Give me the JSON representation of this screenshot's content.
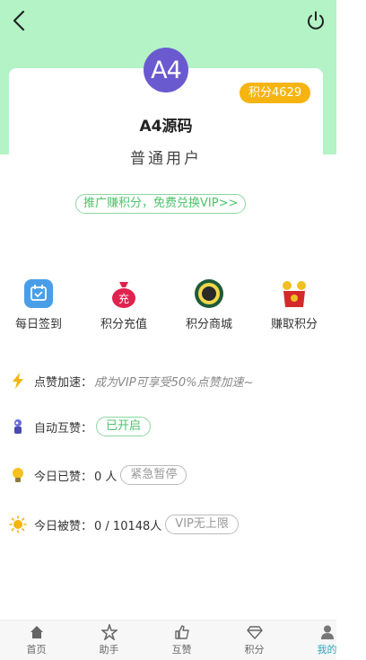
{
  "header": {
    "back_icon": "back-arrow-icon",
    "power_icon": "power-icon"
  },
  "profile": {
    "avatar_text": "A4",
    "points_badge": "积分4629",
    "name": "A4源码",
    "user_type": "普通用户",
    "promo_link": "推广赚积分，免费兑换VIP>>"
  },
  "actions": [
    {
      "label": "每日签到",
      "icon": "calendar-checkin-icon"
    },
    {
      "label": "积分充值",
      "icon": "money-bag-icon"
    },
    {
      "label": "积分商城",
      "icon": "points-mall-icon"
    },
    {
      "label": "赚取积分",
      "icon": "gift-bag-icon"
    }
  ],
  "rows": {
    "speed": {
      "label": "点赞加速：",
      "desc": "成为VIP可享受50%点赞加速~",
      "icon": "lightning-icon"
    },
    "auto": {
      "label": "自动互赞：",
      "status": "已开启",
      "icon": "robot-icon"
    },
    "today_liked": {
      "label": "今日已赞：",
      "value": "0 人",
      "button": "紧急暂停",
      "icon": "lightbulb-icon"
    },
    "today_received": {
      "label": "今日被赞：",
      "value": "0 / 10148人",
      "badge": "VIP无上限",
      "icon": "sun-icon"
    }
  },
  "tabbar": [
    {
      "label": "首页",
      "icon": "home-icon"
    },
    {
      "label": "助手",
      "icon": "star-assistant-icon"
    },
    {
      "label": "互赞",
      "icon": "thumbs-up-icon"
    },
    {
      "label": "积分",
      "icon": "diamond-icon"
    },
    {
      "label": "我的",
      "icon": "user-icon",
      "active": true
    }
  ],
  "colors": {
    "header_bg": "#b3f3c6",
    "badge": "#f5b40f",
    "accent_green": "#4cc36a",
    "active_tab": "#28a9c2"
  }
}
